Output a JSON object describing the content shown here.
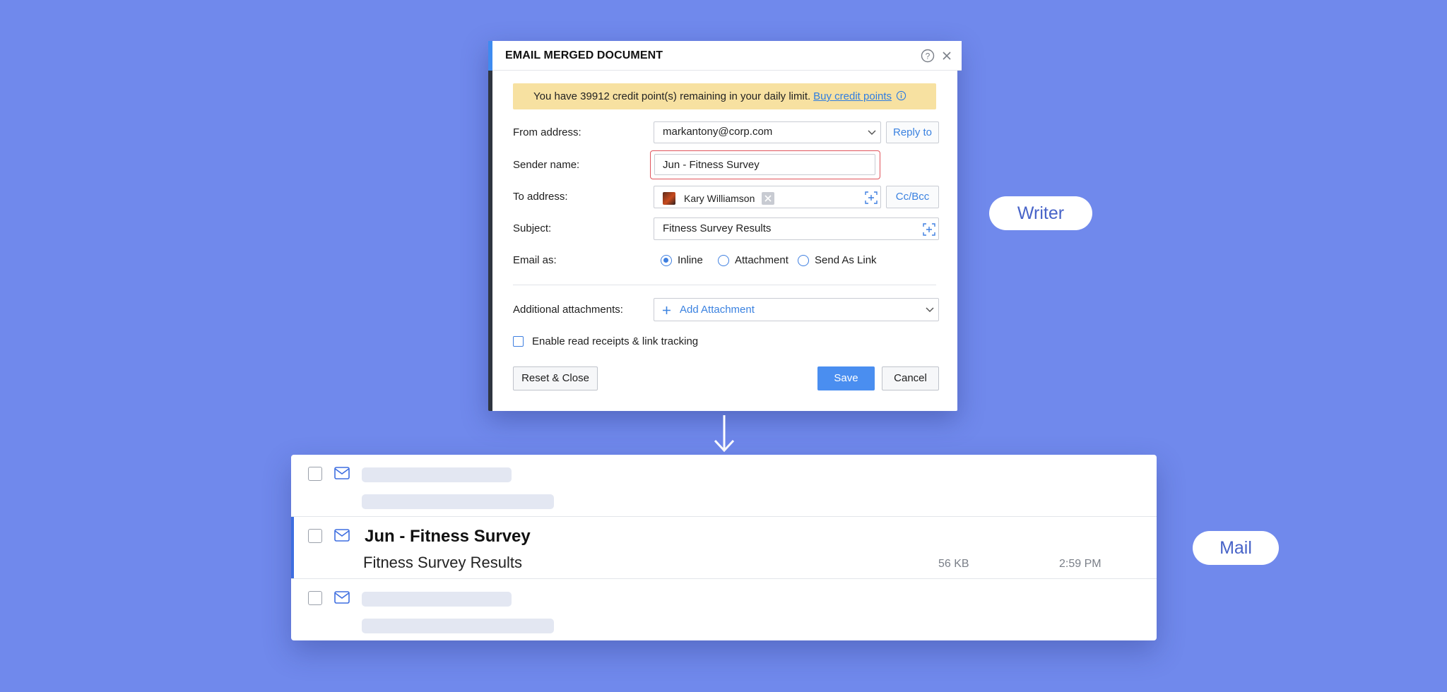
{
  "dialog": {
    "title": "EMAIL MERGED DOCUMENT",
    "banner": {
      "text": "You have 39912 credit point(s) remaining in your daily limit.",
      "link": "Buy credit points"
    },
    "from": {
      "label": "From address:",
      "value": "markantony@corp.com",
      "reply_to": "Reply to"
    },
    "sender": {
      "label": "Sender name:",
      "value": "Jun - Fitness Survey"
    },
    "to": {
      "label": "To address:",
      "recipient": "Kary Williamson",
      "cc_bcc": "Cc/Bcc"
    },
    "subject": {
      "label": "Subject:",
      "value": "Fitness Survey Results"
    },
    "email_as": {
      "label": "Email as:",
      "options": [
        "Inline",
        "Attachment",
        "Send As Link"
      ],
      "selected": "Inline"
    },
    "attachments": {
      "label": "Additional attachments:",
      "button": "Add Attachment"
    },
    "read_receipts": {
      "label": "Enable read receipts & link tracking",
      "checked": false
    },
    "buttons": {
      "reset": "Reset & Close",
      "save": "Save",
      "cancel": "Cancel"
    }
  },
  "pills": {
    "writer": "Writer",
    "mail": "Mail"
  },
  "mail": {
    "message": {
      "subject": "Jun - Fitness Survey",
      "preview": "Fitness Survey Results",
      "size": "56 KB",
      "time": "2:59 PM"
    }
  },
  "colors": {
    "background": "#7089ec",
    "accent": "#4a8ef0",
    "highlight_border": "#e0535b",
    "banner": "#f7e1a1"
  }
}
